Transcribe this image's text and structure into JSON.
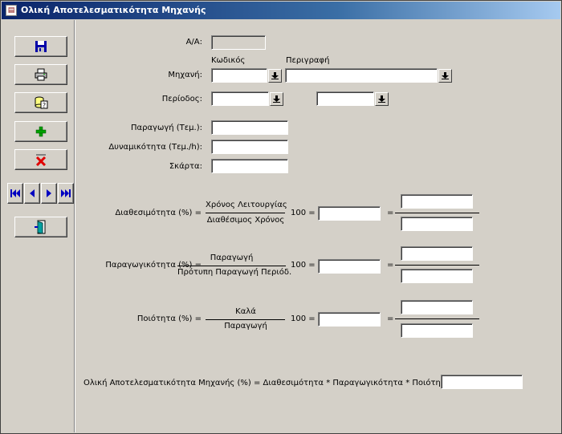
{
  "window": {
    "title": "Ολική Αποτελεσματικότητα Μηχανής",
    "icon": "app-form-icon"
  },
  "toolbar": {
    "buttons": [
      {
        "name": "save-button",
        "icon": "floppy-disk-icon"
      },
      {
        "name": "print-button",
        "icon": "printer-icon"
      },
      {
        "name": "query-button",
        "icon": "question-database-icon"
      },
      {
        "name": "add-button",
        "icon": "green-plus-icon"
      },
      {
        "name": "delete-button",
        "icon": "red-x-icon"
      },
      {
        "name": "exit-button",
        "icon": "exit-door-icon"
      }
    ],
    "nav": [
      "first-record-icon",
      "previous-record-icon",
      "next-record-icon",
      "last-record-icon"
    ]
  },
  "form": {
    "aa_label": "Α/Α:",
    "aa_value": "",
    "code_header": "Κωδικός",
    "desc_header": "Περιγραφή",
    "machine_label": "Μηχανή:",
    "machine_code": "",
    "machine_desc": "",
    "period_label": "Περίοδος:",
    "period_from": "",
    "period_to": "",
    "production_label": "Παραγωγή (Τεμ.):",
    "production_value": "",
    "capacity_label": "Δυναμικότητα (Τεμ./h):",
    "capacity_value": "",
    "scrap_label": "Σκάρτα:",
    "scrap_value": ""
  },
  "formulas": {
    "availability": {
      "label": "Διαθεσιμότητα (%) =",
      "numerator": "Χρόνος Λειτουργίας",
      "denominator": "Διαθέσιμος Χρόνος",
      "factor": "100 =",
      "equals": "="
    },
    "productivity": {
      "label": "Παραγωγικότητα (%) =",
      "numerator": "Παραγωγή",
      "denominator": "Πρότυπη Παραγωγή Περιόδ.",
      "factor": "100 =",
      "equals": "="
    },
    "quality": {
      "label": "Ποιότητα (%) =",
      "numerator": "Καλά",
      "denominator": "Παραγωγή",
      "factor": "100 =",
      "equals": "="
    },
    "oee": {
      "label": "Ολική Αποτελεσματικότητα Μηχανής (%) = Διαθεσιμότητα * Παραγωγικότητα * Ποιότητα =",
      "value": ""
    }
  },
  "colors": {
    "titlebar_start": "#0a246a",
    "titlebar_end": "#a6caf0",
    "face": "#d4d0c8"
  }
}
